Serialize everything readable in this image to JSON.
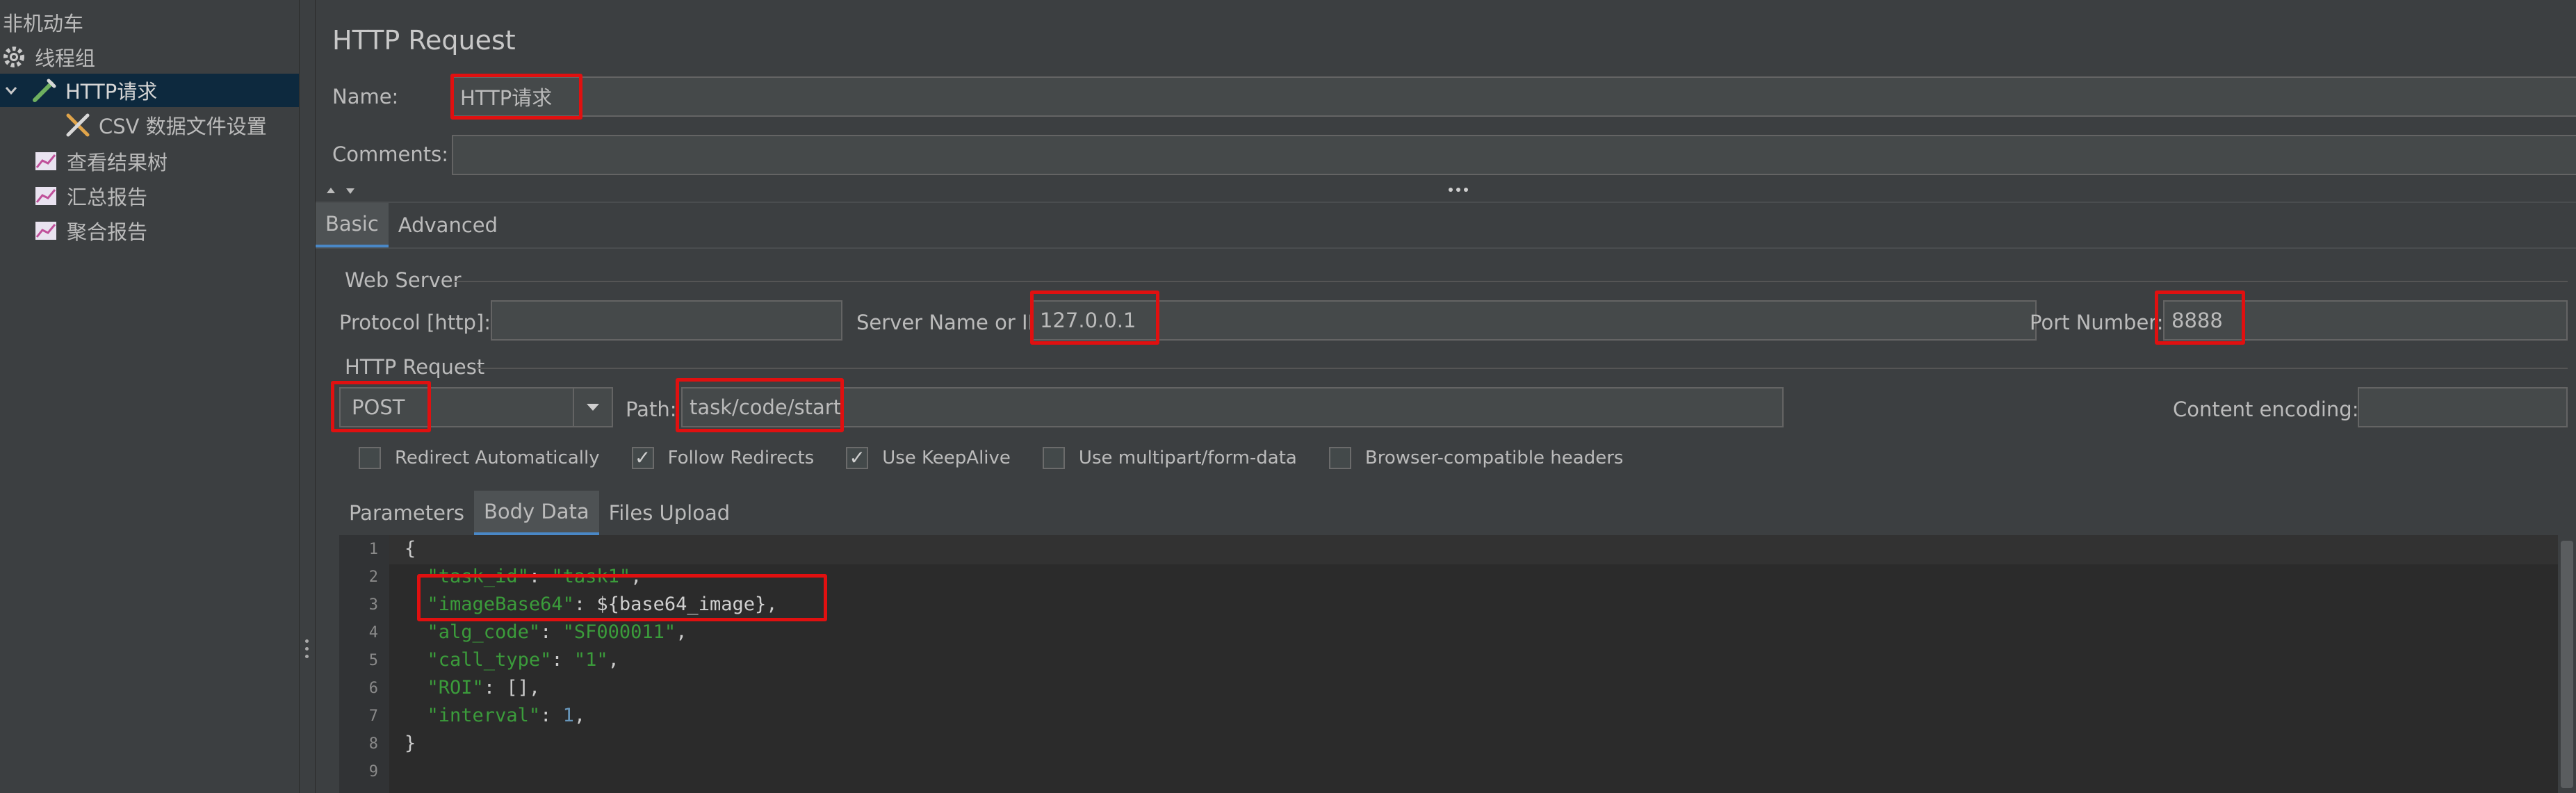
{
  "tree": {
    "items": [
      {
        "label": "非机动车",
        "icon": "none"
      },
      {
        "label": "线程组",
        "icon": "gear-icon"
      },
      {
        "label": "HTTP请求",
        "icon": "pipette-icon"
      },
      {
        "label": "CSV 数据文件设置",
        "icon": "tools-icon"
      },
      {
        "label": "查看结果树",
        "icon": "chart-icon"
      },
      {
        "label": "汇总报告",
        "icon": "chart-icon"
      },
      {
        "label": "聚合报告",
        "icon": "chart-icon"
      }
    ]
  },
  "panel": {
    "title": "HTTP Request",
    "name_label": "Name:",
    "name_value": "HTTP请求",
    "comments_label": "Comments:",
    "comments_value": "",
    "tabs": [
      {
        "label": "Basic"
      },
      {
        "label": "Advanced"
      }
    ],
    "web_server": {
      "title": "Web Server",
      "protocol_label": "Protocol [http]:",
      "protocol_value": "",
      "server_label": "Server Name or IP:",
      "server_value": "127.0.0.1",
      "port_label": "Port Number:",
      "port_value": "8888"
    },
    "http_request": {
      "title": "HTTP Request",
      "method": "POST",
      "path_label": "Path:",
      "path_value": "task/code/start",
      "encoding_label": "Content encoding:",
      "encoding_value": ""
    },
    "checkboxes": [
      {
        "label": "Redirect Automatically",
        "checked": false
      },
      {
        "label": "Follow Redirects",
        "checked": true
      },
      {
        "label": "Use KeepAlive",
        "checked": true
      },
      {
        "label": "Use multipart/form-data",
        "checked": false
      },
      {
        "label": "Browser-compatible headers",
        "checked": false
      }
    ],
    "body_tabs": [
      {
        "label": "Parameters"
      },
      {
        "label": "Body Data"
      },
      {
        "label": "Files Upload"
      }
    ],
    "body_lines": [
      {
        "num": "1",
        "text": "{"
      },
      {
        "num": "2",
        "text": "  \"task_id\": \"task1\","
      },
      {
        "num": "3",
        "text": "  \"imageBase64\": ${base64_image},"
      },
      {
        "num": "4",
        "text": "  \"alg_code\": \"SF000011\","
      },
      {
        "num": "5",
        "text": "  \"call_type\": \"1\","
      },
      {
        "num": "6",
        "text": "  \"ROI\": [],"
      },
      {
        "num": "7",
        "text": "  \"interval\": 1,"
      },
      {
        "num": "8",
        "text": "}"
      },
      {
        "num": "9",
        "text": ""
      }
    ]
  },
  "colors": {
    "background": "#3c3f41",
    "selection": "#0d293e",
    "highlight_box": "#e01010",
    "string": "#3b9c3b",
    "number": "#6897bb",
    "accent": "#4a88c7"
  }
}
